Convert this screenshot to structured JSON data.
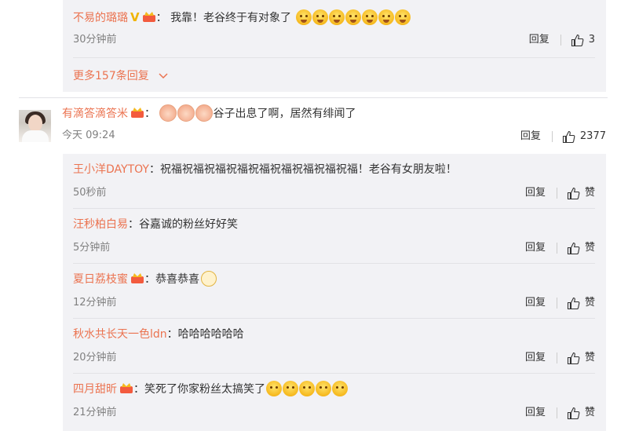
{
  "thread_top": {
    "name": "不易的璐璐",
    "text": "我靠！老谷终于有对象了",
    "time": "30分钟前",
    "reply": "回复",
    "likes": "3",
    "more": "更多157条回复",
    "cry_emoji_count": 7
  },
  "main_comment": {
    "name": "有滴答滴答米",
    "text": "谷子出息了啊，居然有绯闻了",
    "time": "今天 09:24",
    "reply": "回复",
    "likes": "2377"
  },
  "replies": [
    {
      "name": "王小洋DAYTOY",
      "colon": "：",
      "text": "祝福祝福祝福祝福祝福祝福祝福祝福祝福！老谷有女朋友啦！",
      "time": "50秒前",
      "reply": "回复",
      "like": "赞"
    },
    {
      "name": "汪秒柏白易",
      "colon": "：",
      "text": "谷嘉诚的粉丝好好笑",
      "time": "5分钟前",
      "reply": "回复",
      "like": "赞"
    },
    {
      "name": "夏日荔枝蜜",
      "colon": "：",
      "text": "恭喜恭喜",
      "time": "12分钟前",
      "reply": "回复",
      "like": "赞"
    },
    {
      "name": "秋水共长天一色ldn",
      "colon": "：",
      "text": "哈哈哈哈哈哈",
      "time": "20分钟前",
      "reply": "回复",
      "like": "赞"
    },
    {
      "name": "四月甜昕",
      "colon": "：",
      "text": "笑死了你家粉丝太搞笑了",
      "time": "21分钟前",
      "reply": "回复",
      "like": "赞"
    }
  ],
  "colors": {
    "name": "#eb7350",
    "time": "#808080",
    "panel": "#f2f2f5",
    "vip_gold": "#f0b400"
  }
}
